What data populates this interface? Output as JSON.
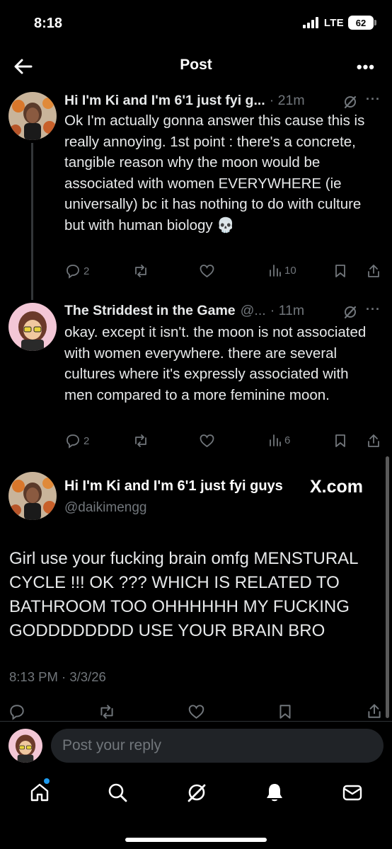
{
  "status_bar": {
    "time": "8:18",
    "network": "LTE",
    "battery": "62"
  },
  "header": {
    "title": "Post",
    "back_icon": "arrow-left-icon",
    "more_label": "•••"
  },
  "thread": [
    {
      "name": "Hi I'm Ki and I'm 6'1 just fyi g...",
      "time": "· 21m",
      "text": "Ok I'm actually gonna answer this cause this is really annoying. 1st point : there's a concrete, tangible reason why the moon would be associated with women EVERYWHERE (ie universally) bc it has nothing to do with culture but with human biology 💀",
      "replies": "2",
      "views": "10"
    },
    {
      "name": "The Striddest in the Game",
      "handle": "@...",
      "time": "· 11m",
      "text": "okay. except it isn't. the moon is not associated with women everywhere. there are several cultures where it's expressly associated with men compared to a more feminine moon.",
      "replies": "2",
      "views": "6"
    }
  ],
  "main_post": {
    "name": "Hi I'm Ki and I'm 6'1 just fyi guys",
    "handle": "@daikimengg",
    "watermark": "X.com",
    "text": "Girl use your fucking brain omfg MENSTURAL CYCLE !!! OK ??? WHICH IS RELATED TO BATHROOM TOO OHHHHHH MY FUCKING GODDDDDDDD USE YOUR BRAIN BRO",
    "timestamp": "8:13 PM · 3/3/26"
  },
  "reply_bar": {
    "placeholder": "Post your reply"
  },
  "bottom_nav": [
    "home-icon",
    "search-icon",
    "grok-icon",
    "notifications-icon",
    "messages-icon"
  ],
  "colors": {
    "background": "#000000",
    "text": "#e7e9ea",
    "secondary": "#71767b",
    "accent": "#1d9bf0"
  }
}
